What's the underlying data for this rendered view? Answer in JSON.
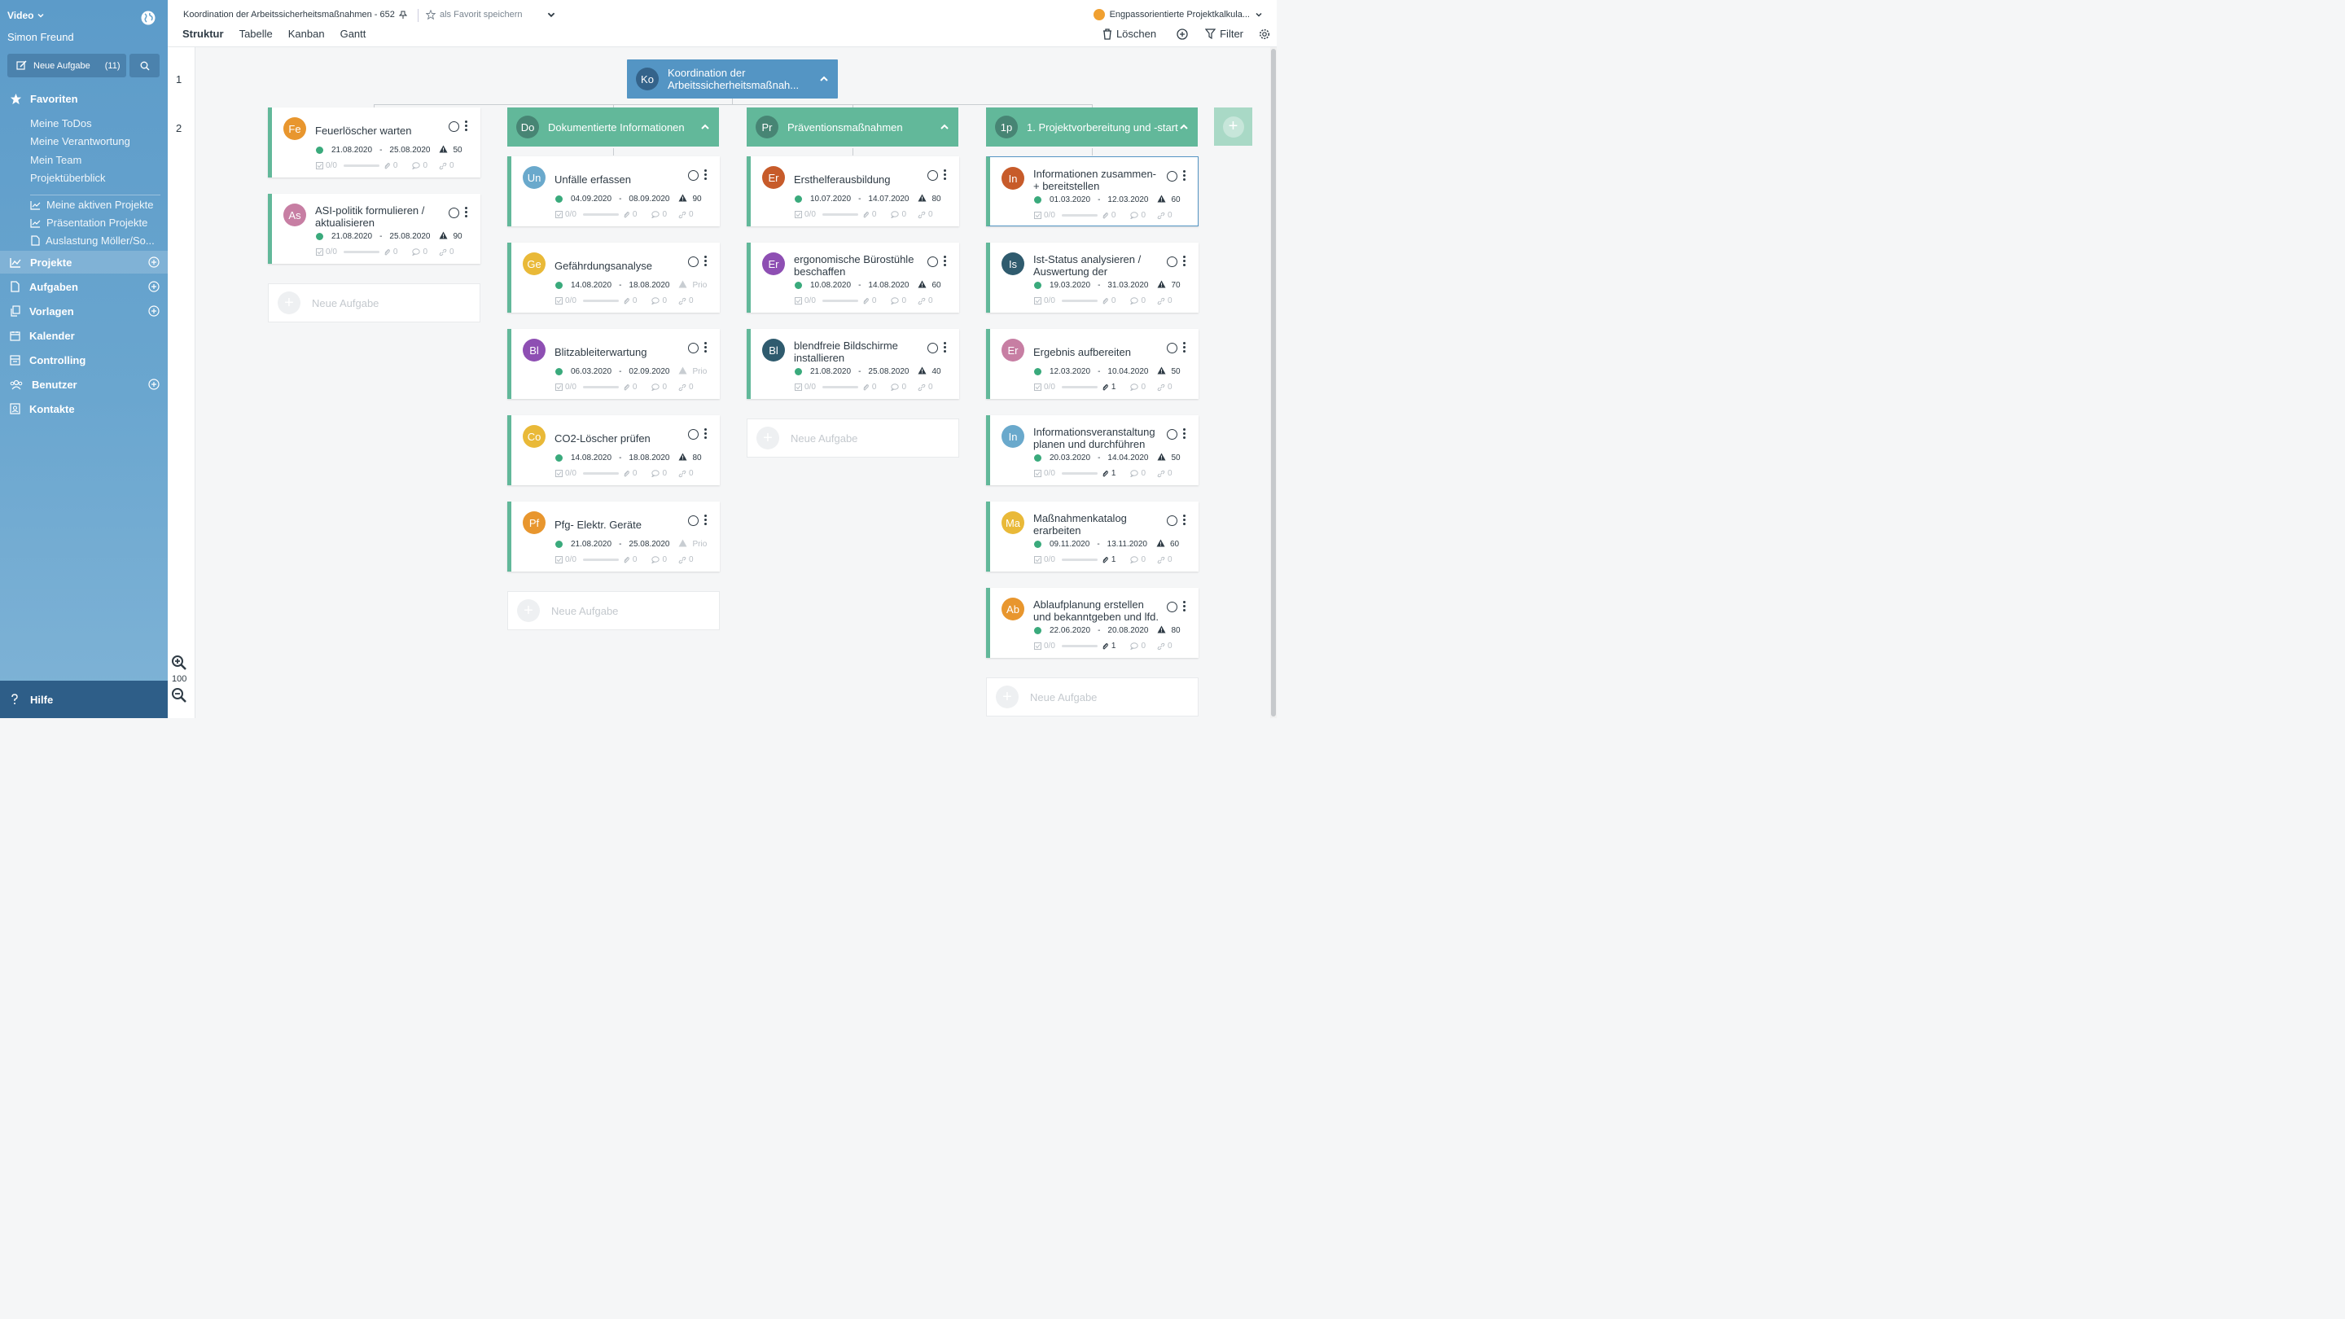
{
  "sidebar": {
    "workspace": "Video",
    "user": "Simon Freund",
    "new_task_label": "Neue Aufgabe",
    "new_task_count": "(11)",
    "favorites_label": "Favoriten",
    "fav_items": [
      "Meine ToDos",
      "Meine Verantwortung",
      "Mein Team",
      "Projektüberblick"
    ],
    "fav_reports": [
      "Meine aktiven Projekte",
      "Präsentation Projekte",
      "Auslastung Möller/So..."
    ],
    "nav": [
      "Projekte",
      "Aufgaben",
      "Vorlagen",
      "Kalender",
      "Controlling",
      "Benutzer",
      "Kontakte"
    ],
    "help": "Hilfe"
  },
  "header": {
    "project_title": "Koordination der Arbeitssicherheitsmaßnahmen - 652",
    "favorite_label": "als Favorit speichern",
    "tabs": [
      "Struktur",
      "Tabelle",
      "Kanban",
      "Gantt"
    ],
    "right_project": "Engpassorientierte Projektkalkula...",
    "delete": "Löschen",
    "filter": "Filter"
  },
  "canvas": {
    "levels": [
      "1",
      "2"
    ],
    "zoom": "100",
    "root": {
      "avatar": "Ko",
      "title": "Koordination der Arbeitssicherheitsmaßnah..."
    },
    "new_task": "Neue Aufgabe",
    "columns": [
      {
        "header": null,
        "cards": [
          {
            "avatar": "Fe",
            "title": "Feuerlöscher warten",
            "start": "21.08.2020",
            "end": "25.08.2020",
            "prio": "50",
            "checklist": "0/0",
            "attachments": "0",
            "comments": "0",
            "links": "0"
          },
          {
            "avatar": "As",
            "title": "ASI-politik formulieren / aktualisieren",
            "start": "21.08.2020",
            "end": "25.08.2020",
            "prio": "90",
            "checklist": "0/0",
            "attachments": "0",
            "comments": "0",
            "links": "0"
          }
        ]
      },
      {
        "header": {
          "avatar": "Do",
          "title": "Dokumentierte Informationen"
        },
        "cards": [
          {
            "avatar": "Un",
            "title": "Unfälle erfassen",
            "start": "04.09.2020",
            "end": "08.09.2020",
            "prio": "90",
            "checklist": "0/0",
            "attachments": "0",
            "comments": "0",
            "links": "0"
          },
          {
            "avatar": "Ge",
            "title": "Gefährdungsanalyse",
            "start": "14.08.2020",
            "end": "18.08.2020",
            "prio": "Prio",
            "checklist": "0/0",
            "attachments": "0",
            "comments": "0",
            "links": "0"
          },
          {
            "avatar": "Bl",
            "title": "Blitzableiterwartung",
            "start": "06.03.2020",
            "end": "02.09.2020",
            "prio": "Prio",
            "checklist": "0/0",
            "attachments": "0",
            "comments": "0",
            "links": "0"
          },
          {
            "avatar": "Co",
            "title": "CO2-Löscher prüfen",
            "start": "14.08.2020",
            "end": "18.08.2020",
            "prio": "80",
            "checklist": "0/0",
            "attachments": "0",
            "comments": "0",
            "links": "0"
          },
          {
            "avatar": "Pf",
            "title": "Pfg- Elektr. Geräte",
            "start": "21.08.2020",
            "end": "25.08.2020",
            "prio": "Prio",
            "checklist": "0/0",
            "attachments": "0",
            "comments": "0",
            "links": "0"
          }
        ]
      },
      {
        "header": {
          "avatar": "Pr",
          "title": "Präventionsmaßnahmen"
        },
        "cards": [
          {
            "avatar": "Er",
            "title": "Ersthelferausbildung",
            "start": "10.07.2020",
            "end": "14.07.2020",
            "prio": "80",
            "checklist": "0/0",
            "attachments": "0",
            "comments": "0",
            "links": "0"
          },
          {
            "avatar": "Er",
            "title": "ergonomische Bürostühle beschaffen",
            "start": "10.08.2020",
            "end": "14.08.2020",
            "prio": "60",
            "checklist": "0/0",
            "attachments": "0",
            "comments": "0",
            "links": "0"
          },
          {
            "avatar": "Bl",
            "title": "blendfreie Bildschirme installieren",
            "start": "21.08.2020",
            "end": "25.08.2020",
            "prio": "40",
            "checklist": "0/0",
            "attachments": "0",
            "comments": "0",
            "links": "0"
          }
        ]
      },
      {
        "header": {
          "avatar": "1p",
          "title": "1. Projektvorbereitung und -start"
        },
        "cards": [
          {
            "avatar": "In",
            "title": "Informationen zusammen- + bereitstellen",
            "start": "01.03.2020",
            "end": "12.03.2020",
            "prio": "60",
            "checklist": "0/0",
            "attachments": "0",
            "comments": "0",
            "links": "0"
          },
          {
            "avatar": "Is",
            "title": "Ist-Status analysieren / Auswertung der",
            "start": "19.03.2020",
            "end": "31.03.2020",
            "prio": "70",
            "checklist": "0/0",
            "attachments": "0",
            "comments": "0",
            "links": "0"
          },
          {
            "avatar": "Er",
            "title": "Ergebnis aufbereiten",
            "start": "12.03.2020",
            "end": "10.04.2020",
            "prio": "50",
            "checklist": "0/0",
            "attachments": "1",
            "comments": "0",
            "links": "0"
          },
          {
            "avatar": "In",
            "title": "Informationsveranstaltung planen und durchführen",
            "start": "20.03.2020",
            "end": "14.04.2020",
            "prio": "50",
            "checklist": "0/0",
            "attachments": "1",
            "comments": "0",
            "links": "0"
          },
          {
            "avatar": "Ma",
            "title": "Maßnahmenkatalog erarbeiten",
            "start": "09.11.2020",
            "end": "13.11.2020",
            "prio": "60",
            "checklist": "0/0",
            "attachments": "1",
            "comments": "0",
            "links": "0"
          },
          {
            "avatar": "Ab",
            "title": "Ablaufplanung erstellen und bekanntgeben und lfd.",
            "start": "22.06.2020",
            "end": "20.08.2020",
            "prio": "80",
            "checklist": "0/0",
            "attachments": "1",
            "comments": "0",
            "links": "0"
          }
        ]
      }
    ]
  },
  "colors": {
    "sidebar": "#6aa6cf",
    "root_node": "#5495c4",
    "column_header": "#62b89a",
    "status_dot": "#3aaa7c",
    "avatar_orange": "#e8962e",
    "avatar_mustard": "#e9b938",
    "avatar_purple": "#8e4fb3",
    "avatar_pink": "#c77ea3",
    "avatar_blue": "#6aa9cc",
    "avatar_rust": "#c75b2a",
    "avatar_teal": "#2f5b6e"
  }
}
